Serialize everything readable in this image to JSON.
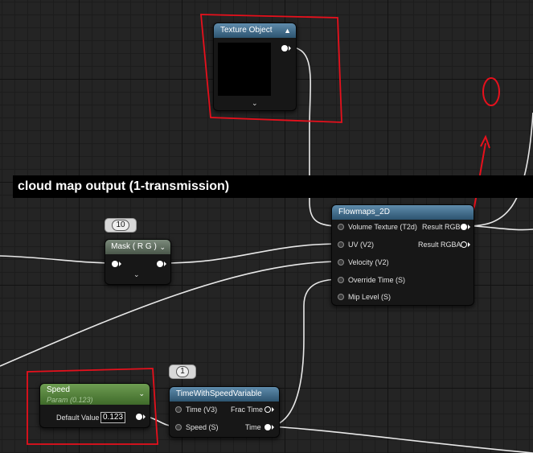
{
  "comment": {
    "title": "cloud map output (1-transmission)"
  },
  "texture_object": {
    "title": "Texture Object"
  },
  "flowmaps": {
    "title": "Flowmaps_2D",
    "inputs": [
      "Volume Texture (T2d)",
      "UV (V2)",
      "Velocity (V2)",
      "Override Time (S)",
      "Mip Level (S)"
    ],
    "outputs": [
      "Result RGB",
      "Result RGBA"
    ]
  },
  "mask": {
    "title": "Mask ( R G )",
    "bubble": "10"
  },
  "speed": {
    "title": "Speed",
    "subtitle": "Param (0.123)",
    "default_label": "Default Value",
    "default_value": "0.123"
  },
  "time_node": {
    "title": "TimeWithSpeedVariable",
    "bubble": "1",
    "inputs": [
      "Time (V3)",
      "Speed (S)"
    ],
    "outputs": [
      "Frac Time",
      "Time"
    ]
  },
  "annotation": {
    "handwritten_text": "0",
    "colors": {
      "annotation_red": "#e8101c",
      "header_blue": "#3f6a88",
      "header_green": "#4f7f39"
    }
  }
}
